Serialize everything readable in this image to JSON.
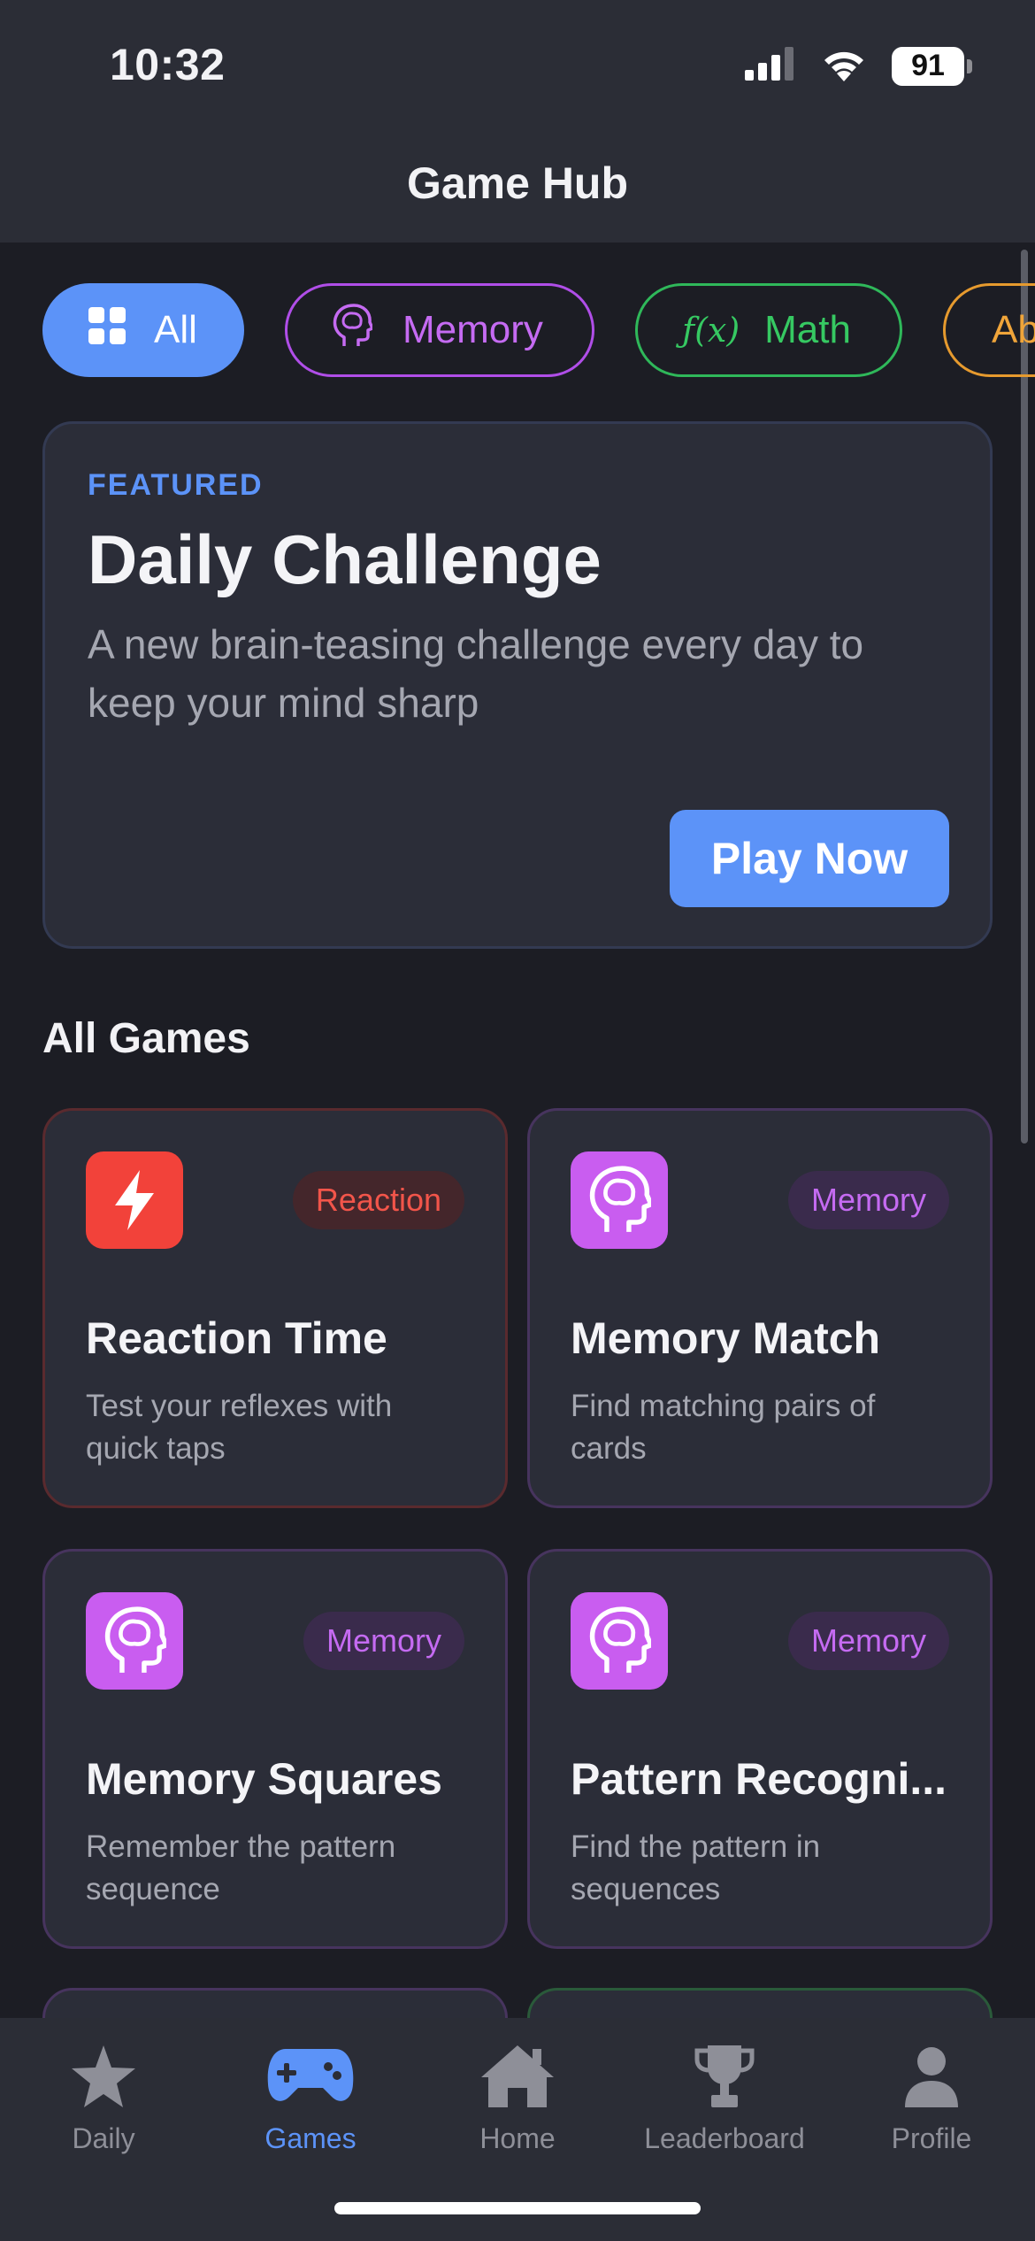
{
  "status_bar": {
    "time": "10:32",
    "battery": "91"
  },
  "header": {
    "title": "Game Hub"
  },
  "filters": [
    {
      "label": "All",
      "icon": "grid-icon",
      "active": true,
      "color": "#5c93f8"
    },
    {
      "label": "Memory",
      "icon": "brain-head-icon",
      "active": false,
      "color": "#b04ee8"
    },
    {
      "label": "Math",
      "icon": "function-icon",
      "icon_text": "ƒ(x)",
      "active": false,
      "color": "#2fb85a"
    },
    {
      "label": "Ab",
      "active": false,
      "color": "#e69a2e"
    }
  ],
  "featured": {
    "label": "FEATURED",
    "title": "Daily Challenge",
    "description": "A new brain-teasing challenge every day to keep your mind sharp",
    "button": "Play Now"
  },
  "section_title": "All Games",
  "games": [
    {
      "title": "Reaction Time",
      "badge": "Reaction",
      "description": "Test your reflexes with quick taps",
      "icon": "lightning-icon",
      "color": "#f2423a"
    },
    {
      "title": "Memory Match",
      "badge": "Memory",
      "description": "Find matching pairs of cards",
      "icon": "brain-head-icon",
      "color": "#c95df0"
    },
    {
      "title": "Memory Squares",
      "badge": "Memory",
      "description": "Remember the pattern sequence",
      "icon": "brain-head-icon",
      "color": "#c95df0"
    },
    {
      "title": "Pattern Recogni...",
      "badge": "Memory",
      "description": "Find the pattern in sequences",
      "icon": "brain-head-icon",
      "color": "#c95df0"
    }
  ],
  "tabs": [
    {
      "label": "Daily",
      "icon": "star-icon",
      "active": false
    },
    {
      "label": "Games",
      "icon": "gamepad-icon",
      "active": true
    },
    {
      "label": "Home",
      "icon": "house-icon",
      "active": false
    },
    {
      "label": "Leaderboard",
      "icon": "trophy-icon",
      "active": false
    },
    {
      "label": "Profile",
      "icon": "person-icon",
      "active": false
    }
  ],
  "colors": {
    "accent": "#5c93f8",
    "background": "#1c1d24",
    "card": "#2b2d38"
  }
}
